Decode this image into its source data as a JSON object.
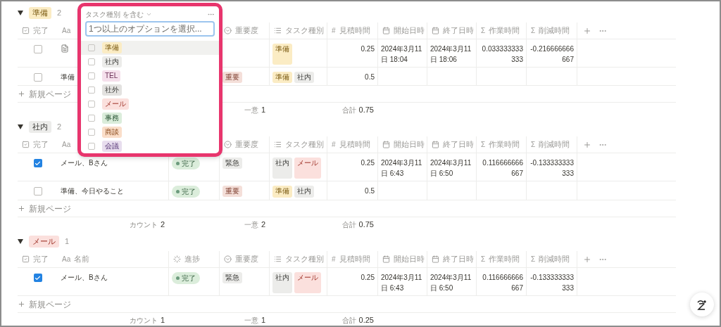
{
  "groups": [
    {
      "tag": {
        "label": "準備",
        "color": "#fbecc4"
      },
      "count": "2",
      "new_label": "新規ページ",
      "columns": [
        {
          "kind": "checkbox",
          "label": "完了"
        },
        {
          "kind": "title",
          "glyph": "Aa"
        },
        {
          "kind": "status"
        },
        {
          "kind": "select",
          "label": "重要度"
        },
        {
          "kind": "multi",
          "label": "タスク種別"
        },
        {
          "kind": "number",
          "glyph": "#",
          "label": "見積時間"
        },
        {
          "kind": "date",
          "label": "開始日時"
        },
        {
          "kind": "date",
          "label": "終了日時"
        },
        {
          "kind": "formula",
          "glyph": "Σ",
          "label": "作業時間"
        },
        {
          "kind": "formula",
          "glyph": "Σ",
          "label": "削減時間"
        }
      ],
      "rows": [
        {
          "cells": [
            {
              "checked": false
            },
            {
              "kind": "page"
            },
            {},
            {},
            {
              "tags": [
                {
                  "label": "準備",
                  "color": "#fbecc4"
                }
              ]
            },
            {
              "text": "0.25"
            },
            {
              "text": "2024年3月11日 18:04"
            },
            {
              "text": "2024年3月11日 18:06"
            },
            {
              "text": "0.033333333333"
            },
            {
              "text": "-0.216666666667"
            }
          ]
        },
        {
          "cells": [
            {
              "checked": false
            },
            {
              "text": "準備"
            },
            {},
            {
              "tag": {
                "label": "重要",
                "color": "#f4dfd9"
              }
            },
            {
              "tags": [
                {
                  "label": "準備",
                  "color": "#fbecc4"
                },
                {
                  "label": "社内",
                  "color": "#ececea"
                }
              ]
            },
            {
              "text": "0.5"
            },
            {},
            {},
            {},
            {}
          ]
        }
      ],
      "footer": {
        "select": {
          "label": "一意",
          "value": "1"
        },
        "number": {
          "label": "合計",
          "value": "0.75"
        }
      }
    },
    {
      "tag": {
        "label": "社内",
        "color": "#ececea"
      },
      "count": "2",
      "new_label": "新規ページ",
      "columns": [
        {
          "kind": "checkbox",
          "label": "完了"
        },
        {
          "kind": "title",
          "glyph": "Aa"
        },
        {
          "kind": "status"
        },
        {
          "kind": "select",
          "label": "重要度"
        },
        {
          "kind": "multi",
          "label": "タスク種別"
        },
        {
          "kind": "number",
          "glyph": "#",
          "label": "見積時間"
        },
        {
          "kind": "date",
          "label": "開始日時"
        },
        {
          "kind": "date",
          "label": "終了日時"
        },
        {
          "kind": "formula",
          "glyph": "Σ",
          "label": "作業時間"
        },
        {
          "kind": "formula",
          "glyph": "Σ",
          "label": "削減時間"
        }
      ],
      "rows": [
        {
          "cells": [
            {
              "checked": true
            },
            {
              "text": "メール、Bさん"
            },
            {
              "status": "完了"
            },
            {
              "tag": {
                "label": "緊急",
                "color": "#ececea"
              }
            },
            {
              "tags": [
                {
                  "label": "社内",
                  "color": "#ececea"
                },
                {
                  "label": "メール",
                  "color": "#fbe0dd"
                }
              ]
            },
            {
              "text": "0.25"
            },
            {
              "text": "2024年3月11日 6:43"
            },
            {
              "text": "2024年3月11日 6:50"
            },
            {
              "text": "0.116666666667"
            },
            {
              "text": "-0.133333333333"
            }
          ]
        },
        {
          "cells": [
            {
              "checked": false
            },
            {
              "text": "準備、今日やること"
            },
            {
              "status": "完了"
            },
            {
              "tag": {
                "label": "重要",
                "color": "#f4dfd9"
              }
            },
            {
              "tags": [
                {
                  "label": "準備",
                  "color": "#fbecc4"
                },
                {
                  "label": "社内",
                  "color": "#ececea"
                }
              ]
            },
            {
              "text": "0.5"
            },
            {},
            {},
            {},
            {}
          ]
        }
      ],
      "footer": {
        "title": {
          "label": "カウント",
          "value": "2"
        },
        "select": {
          "label": "一意",
          "value": "2"
        },
        "number": {
          "label": "合計",
          "value": "0.75"
        }
      }
    },
    {
      "tag": {
        "label": "メール",
        "color": "#fbe0dd"
      },
      "count": "1",
      "new_label": "新規ページ",
      "columns": [
        {
          "kind": "checkbox",
          "label": "完了"
        },
        {
          "kind": "title",
          "glyph": "Aa",
          "label": "名前"
        },
        {
          "kind": "status",
          "label": "進捗"
        },
        {
          "kind": "select",
          "label": "重要度"
        },
        {
          "kind": "multi",
          "label": "タスク種別"
        },
        {
          "kind": "number",
          "glyph": "#",
          "label": "見積時間"
        },
        {
          "kind": "date",
          "label": "開始日時"
        },
        {
          "kind": "date",
          "label": "終了日時"
        },
        {
          "kind": "formula",
          "glyph": "Σ",
          "label": "作業時間"
        },
        {
          "kind": "formula",
          "glyph": "Σ",
          "label": "削減時間"
        }
      ],
      "rows": [
        {
          "cells": [
            {
              "checked": true
            },
            {
              "text": "メール、Bさん"
            },
            {
              "status": "完了"
            },
            {
              "tag": {
                "label": "緊急",
                "color": "#ececea"
              }
            },
            {
              "tags": [
                {
                  "label": "社内",
                  "color": "#ececea"
                },
                {
                  "label": "メール",
                  "color": "#fbe0dd"
                }
              ]
            },
            {
              "text": "0.25"
            },
            {
              "text": "2024年3月11日 6:43"
            },
            {
              "text": "2024年3月11日 6:50"
            },
            {
              "text": "0.116666666667"
            },
            {
              "text": "-0.133333333333"
            }
          ]
        }
      ],
      "footer": {
        "title": {
          "label": "カウント",
          "value": "1"
        },
        "select": {
          "label": "一意",
          "value": "1"
        },
        "number": {
          "label": "合計",
          "value": "0.25"
        }
      }
    }
  ],
  "filter_popup": {
    "property": "タスク種別",
    "operator": "を含む",
    "placeholder": "1つ以上のオプションを選択...",
    "options": [
      {
        "label": "準備",
        "color": "#fbecc4",
        "selected": true,
        "checked": false
      },
      {
        "label": "社内",
        "color": "#ececea",
        "selected": false,
        "checked": false
      },
      {
        "label": "TEL",
        "color": "#f5e0ec",
        "selected": false,
        "checked": false
      },
      {
        "label": "社外",
        "color": "#e3e2e0",
        "selected": false,
        "checked": false
      },
      {
        "label": "メール",
        "color": "#fbe0dd",
        "selected": false,
        "checked": false
      },
      {
        "label": "事務",
        "color": "#dbeddb",
        "selected": false,
        "checked": false
      },
      {
        "label": "商談",
        "color": "#fadec9",
        "selected": false,
        "checked": false
      },
      {
        "label": "会議",
        "color": "#e8deee",
        "selected": false,
        "checked": false
      }
    ]
  }
}
